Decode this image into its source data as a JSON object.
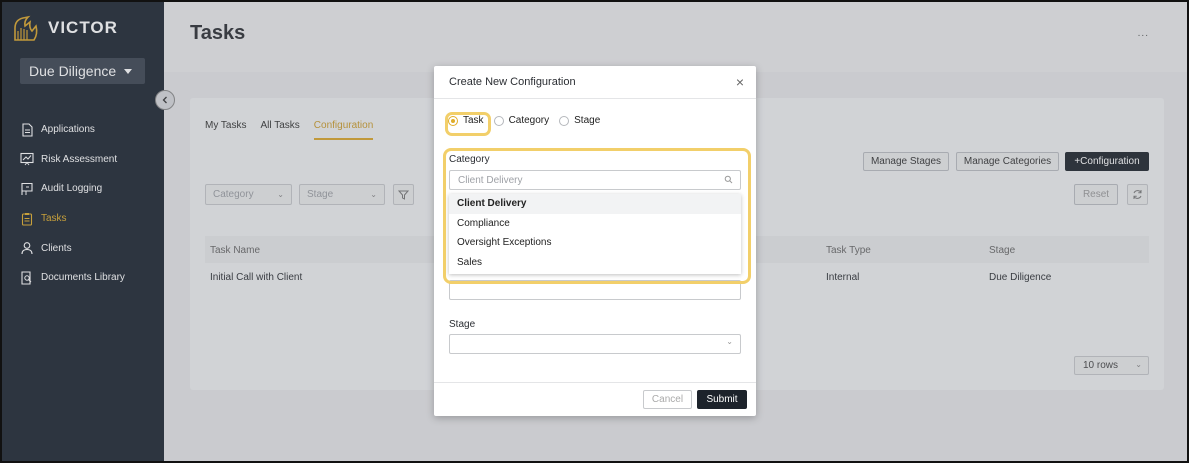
{
  "app": {
    "logo_text": "VICTOR",
    "stage_selector": "Due Diligence"
  },
  "sidebar": {
    "items": [
      {
        "label": "Applications",
        "icon": "document-icon",
        "active": false
      },
      {
        "label": "Risk Assessment",
        "icon": "chart-board-icon",
        "active": false
      },
      {
        "label": "Audit Logging",
        "icon": "flag-board-icon",
        "active": false
      },
      {
        "label": "Tasks",
        "icon": "clipboard-icon",
        "active": true
      },
      {
        "label": "Clients",
        "icon": "person-icon",
        "active": false
      },
      {
        "label": "Documents Library",
        "icon": "document-search-icon",
        "active": false
      }
    ]
  },
  "header": {
    "title": "Tasks",
    "more": "..."
  },
  "tabs": [
    {
      "label": "My Tasks",
      "active": false
    },
    {
      "label": "All Tasks",
      "active": false
    },
    {
      "label": "Configuration",
      "active": true
    }
  ],
  "toolbar": {
    "manage_stages": "Manage Stages",
    "manage_categories": "Manage Categories",
    "add_configuration": "+Configuration",
    "reset": "Reset"
  },
  "filters": {
    "category_placeholder": "Category",
    "stage_placeholder": "Stage"
  },
  "table": {
    "columns": [
      "Task Name",
      "Task Type",
      "Stage"
    ],
    "rows": [
      {
        "task_name": "Initial Call with Client",
        "task_type": "Internal",
        "stage": "Due Diligence"
      }
    ]
  },
  "pagination": {
    "rows_per_page": "10 rows"
  },
  "modal": {
    "title": "Create New Configuration",
    "radio_options": [
      "Task",
      "Category",
      "Stage"
    ],
    "selected_radio": "Task",
    "category_label": "Category",
    "category_placeholder": "Client Delivery",
    "category_options": [
      "Client Delivery",
      "Compliance",
      "Oversight Exceptions",
      "Sales"
    ],
    "stage_label": "Stage",
    "cancel_label": "Cancel",
    "submit_label": "Submit"
  },
  "colors": {
    "sidebar_bg": "#1b2430",
    "accent": "#e0ad2a",
    "highlight": "#f2cf6a",
    "primary_button": "#1d232b"
  }
}
